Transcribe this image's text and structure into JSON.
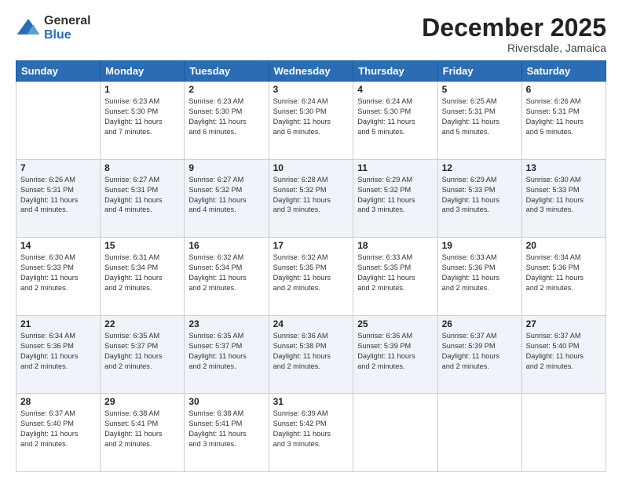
{
  "logo": {
    "general": "General",
    "blue": "Blue"
  },
  "title": "December 2025",
  "subtitle": "Riversdale, Jamaica",
  "days_of_week": [
    "Sunday",
    "Monday",
    "Tuesday",
    "Wednesday",
    "Thursday",
    "Friday",
    "Saturday"
  ],
  "weeks": [
    [
      {
        "day": "",
        "content": ""
      },
      {
        "day": "1",
        "content": "Sunrise: 6:23 AM\nSunset: 5:30 PM\nDaylight: 11 hours\nand 7 minutes."
      },
      {
        "day": "2",
        "content": "Sunrise: 6:23 AM\nSunset: 5:30 PM\nDaylight: 11 hours\nand 6 minutes."
      },
      {
        "day": "3",
        "content": "Sunrise: 6:24 AM\nSunset: 5:30 PM\nDaylight: 11 hours\nand 6 minutes."
      },
      {
        "day": "4",
        "content": "Sunrise: 6:24 AM\nSunset: 5:30 PM\nDaylight: 11 hours\nand 5 minutes."
      },
      {
        "day": "5",
        "content": "Sunrise: 6:25 AM\nSunset: 5:31 PM\nDaylight: 11 hours\nand 5 minutes."
      },
      {
        "day": "6",
        "content": "Sunrise: 6:26 AM\nSunset: 5:31 PM\nDaylight: 11 hours\nand 5 minutes."
      }
    ],
    [
      {
        "day": "7",
        "content": "Sunrise: 6:26 AM\nSunset: 5:31 PM\nDaylight: 11 hours\nand 4 minutes."
      },
      {
        "day": "8",
        "content": "Sunrise: 6:27 AM\nSunset: 5:31 PM\nDaylight: 11 hours\nand 4 minutes."
      },
      {
        "day": "9",
        "content": "Sunrise: 6:27 AM\nSunset: 5:32 PM\nDaylight: 11 hours\nand 4 minutes."
      },
      {
        "day": "10",
        "content": "Sunrise: 6:28 AM\nSunset: 5:32 PM\nDaylight: 11 hours\nand 3 minutes."
      },
      {
        "day": "11",
        "content": "Sunrise: 6:29 AM\nSunset: 5:32 PM\nDaylight: 11 hours\nand 3 minutes."
      },
      {
        "day": "12",
        "content": "Sunrise: 6:29 AM\nSunset: 5:33 PM\nDaylight: 11 hours\nand 3 minutes."
      },
      {
        "day": "13",
        "content": "Sunrise: 6:30 AM\nSunset: 5:33 PM\nDaylight: 11 hours\nand 3 minutes."
      }
    ],
    [
      {
        "day": "14",
        "content": "Sunrise: 6:30 AM\nSunset: 5:33 PM\nDaylight: 11 hours\nand 2 minutes."
      },
      {
        "day": "15",
        "content": "Sunrise: 6:31 AM\nSunset: 5:34 PM\nDaylight: 11 hours\nand 2 minutes."
      },
      {
        "day": "16",
        "content": "Sunrise: 6:32 AM\nSunset: 5:34 PM\nDaylight: 11 hours\nand 2 minutes."
      },
      {
        "day": "17",
        "content": "Sunrise: 6:32 AM\nSunset: 5:35 PM\nDaylight: 11 hours\nand 2 minutes."
      },
      {
        "day": "18",
        "content": "Sunrise: 6:33 AM\nSunset: 5:35 PM\nDaylight: 11 hours\nand 2 minutes."
      },
      {
        "day": "19",
        "content": "Sunrise: 6:33 AM\nSunset: 5:36 PM\nDaylight: 11 hours\nand 2 minutes."
      },
      {
        "day": "20",
        "content": "Sunrise: 6:34 AM\nSunset: 5:36 PM\nDaylight: 11 hours\nand 2 minutes."
      }
    ],
    [
      {
        "day": "21",
        "content": "Sunrise: 6:34 AM\nSunset: 5:36 PM\nDaylight: 11 hours\nand 2 minutes."
      },
      {
        "day": "22",
        "content": "Sunrise: 6:35 AM\nSunset: 5:37 PM\nDaylight: 11 hours\nand 2 minutes."
      },
      {
        "day": "23",
        "content": "Sunrise: 6:35 AM\nSunset: 5:37 PM\nDaylight: 11 hours\nand 2 minutes."
      },
      {
        "day": "24",
        "content": "Sunrise: 6:36 AM\nSunset: 5:38 PM\nDaylight: 11 hours\nand 2 minutes."
      },
      {
        "day": "25",
        "content": "Sunrise: 6:36 AM\nSunset: 5:39 PM\nDaylight: 11 hours\nand 2 minutes."
      },
      {
        "day": "26",
        "content": "Sunrise: 6:37 AM\nSunset: 5:39 PM\nDaylight: 11 hours\nand 2 minutes."
      },
      {
        "day": "27",
        "content": "Sunrise: 6:37 AM\nSunset: 5:40 PM\nDaylight: 11 hours\nand 2 minutes."
      }
    ],
    [
      {
        "day": "28",
        "content": "Sunrise: 6:37 AM\nSunset: 5:40 PM\nDaylight: 11 hours\nand 2 minutes."
      },
      {
        "day": "29",
        "content": "Sunrise: 6:38 AM\nSunset: 5:41 PM\nDaylight: 11 hours\nand 2 minutes."
      },
      {
        "day": "30",
        "content": "Sunrise: 6:38 AM\nSunset: 5:41 PM\nDaylight: 11 hours\nand 3 minutes."
      },
      {
        "day": "31",
        "content": "Sunrise: 6:39 AM\nSunset: 5:42 PM\nDaylight: 11 hours\nand 3 minutes."
      },
      {
        "day": "",
        "content": ""
      },
      {
        "day": "",
        "content": ""
      },
      {
        "day": "",
        "content": ""
      }
    ]
  ]
}
